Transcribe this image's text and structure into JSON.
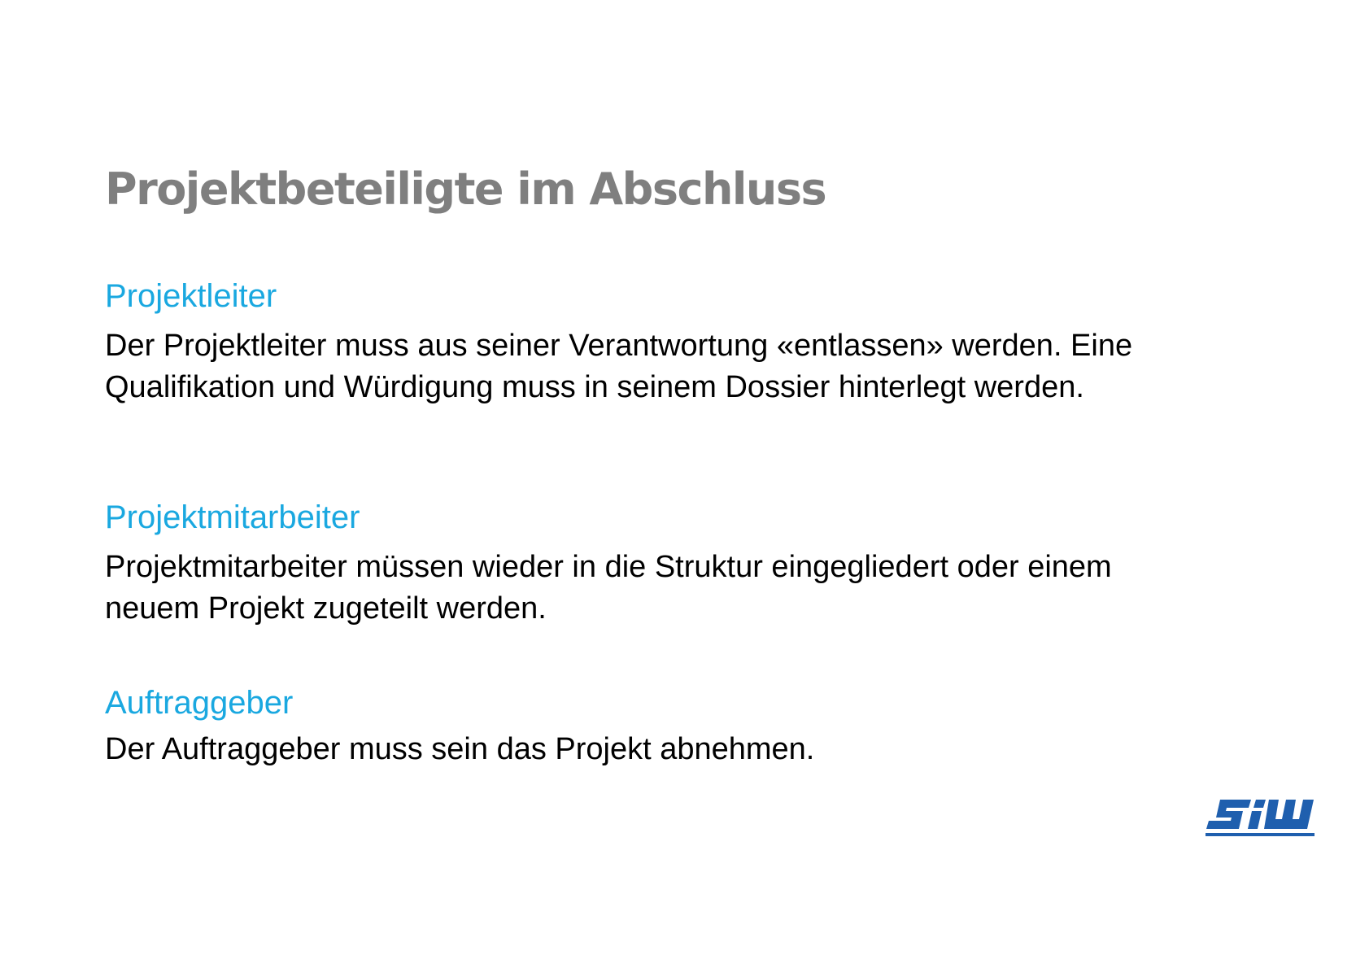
{
  "slide": {
    "title": "Projektbeteiligte im Abschluss",
    "sections": [
      {
        "heading": "Projektleiter",
        "body": "Der Projektleiter muss aus seiner Verantwortung «entlassen» werden. Eine Qualifikation und Würdigung muss in seinem Dossier hinterlegt werden."
      },
      {
        "heading": "Projektmitarbeiter",
        "body": "Projektmitarbeiter müssen wieder in die Struktur eingegliedert oder einem neuem Projekt zugeteilt werden."
      },
      {
        "heading": "Auftraggeber",
        "body": "Der Auftraggeber muss sein das Projekt abnehmen."
      }
    ]
  },
  "logo": {
    "text": "SIW",
    "icon": "siw-logo",
    "color": "#1f5fae"
  },
  "colors": {
    "title": "#7f7f7f",
    "heading": "#1aa8e0",
    "body": "#000000"
  }
}
